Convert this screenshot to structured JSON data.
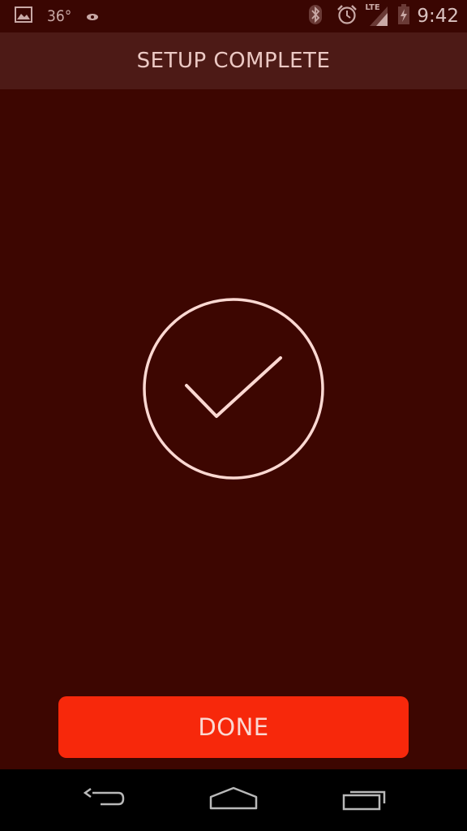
{
  "status_bar": {
    "temperature": "36°",
    "time": "9:42",
    "network_label": "LTE",
    "icons": [
      "image-icon",
      "eye-icon",
      "bluetooth-icon",
      "alarm-icon",
      "signal-icon",
      "battery-charging-icon"
    ]
  },
  "header": {
    "title": "SETUP COMPLETE"
  },
  "main": {
    "icon": "check-circle-icon"
  },
  "actions": {
    "done_label": "DONE"
  },
  "nav": {
    "icons": [
      "back-icon",
      "home-icon",
      "recents-icon"
    ]
  },
  "colors": {
    "background": "#3d0601",
    "header": "#4d1a16",
    "accent": "#f7280b",
    "foreground": "#fbd8d2"
  }
}
